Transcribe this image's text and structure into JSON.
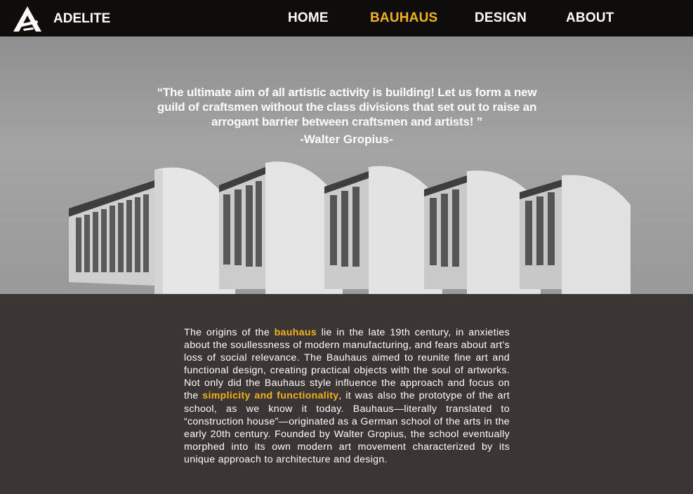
{
  "header": {
    "brand": "ADELITE",
    "nav": [
      {
        "label": "HOME",
        "active": false
      },
      {
        "label": "BAUHAUS",
        "active": true
      },
      {
        "label": "DESIGN",
        "active": false
      },
      {
        "label": "ABOUT",
        "active": false
      }
    ]
  },
  "hero": {
    "quote": "“The ultimate aim of all artistic activity is building! Let us form a new guild of craftsmen without the class divisions that set out to raise an arrogant barrier between craftsmen and artists! ”",
    "author": "-Walter Gropius-"
  },
  "article": {
    "part1": "The origins of the ",
    "highlight1": "bauhaus",
    "part2": " lie in the late 19th century, in anxieties about the soullessness of modern manufacturing, and fears about art’s loss of social relevance. The Bauhaus aimed to reunite fine art and functional design, creating practical objects with the soul of artworks. Not only did the Bauhaus style influence the approach and focus on the ",
    "highlight2": "simplicity and functionality",
    "part3": ", it was also the prototype of the art school, as we know it today. Bauhaus—literally translated to “construction house”—originated as a German school of the arts in the early 20th century. Founded by Walter Gropius, the school eventually morphed into its own modern art movement characterized by its unique approach to architecture and design."
  },
  "colors": {
    "accent": "#f2b21b",
    "topbar": "#0f0d0c",
    "content_bg": "#3b3633"
  }
}
